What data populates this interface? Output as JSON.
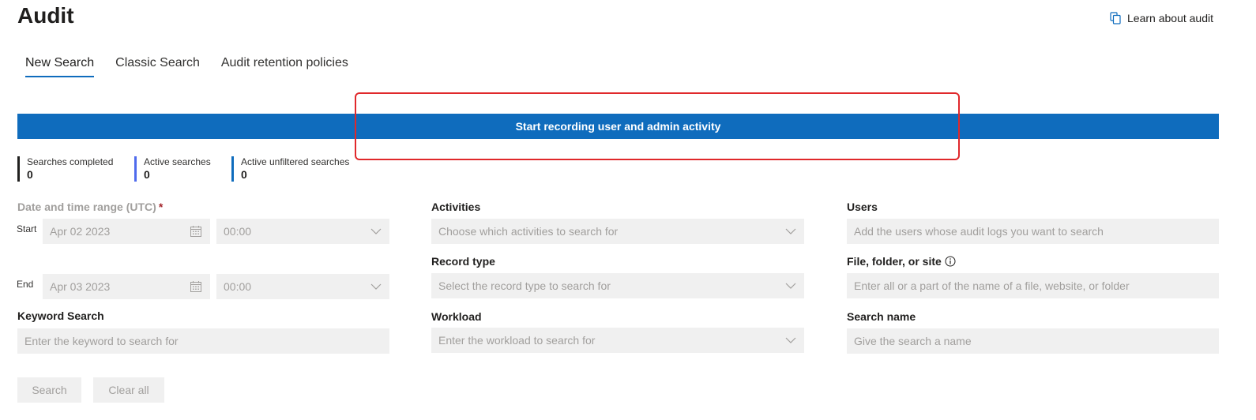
{
  "page": {
    "title": "Audit",
    "learn_link": "Learn about audit"
  },
  "tabs": [
    {
      "label": "New Search",
      "active": true
    },
    {
      "label": "Classic Search",
      "active": false
    },
    {
      "label": "Audit retention policies",
      "active": false
    }
  ],
  "banner": {
    "label": "Start recording user and admin activity"
  },
  "stats": [
    {
      "label": "Searches completed",
      "value": "0",
      "color": "#201f1e"
    },
    {
      "label": "Active searches",
      "value": "0",
      "color": "#4f6bed"
    },
    {
      "label": "Active unfiltered searches",
      "value": "0",
      "color": "#0f6cbd"
    }
  ],
  "form": {
    "date_range": {
      "label": "Date and time range (UTC)",
      "required_mark": "*",
      "start_label": "Start",
      "start_date": "Apr 02 2023",
      "start_time": "00:00",
      "end_label": "End",
      "end_date": "Apr 03 2023",
      "end_time": "00:00"
    },
    "keyword": {
      "label": "Keyword Search",
      "placeholder": "Enter the keyword to search for"
    },
    "activities": {
      "label": "Activities",
      "placeholder": "Choose which activities to search for"
    },
    "record_type": {
      "label": "Record type",
      "placeholder": "Select the record type to search for"
    },
    "workload": {
      "label": "Workload",
      "placeholder": "Enter the workload to search for"
    },
    "users": {
      "label": "Users",
      "placeholder": "Add the users whose audit logs you want to search"
    },
    "file_folder_site": {
      "label": "File, folder, or site",
      "placeholder": "Enter all or a part of the name of a file, website, or folder"
    },
    "search_name": {
      "label": "Search name",
      "placeholder": "Give the search a name"
    }
  },
  "buttons": {
    "search": "Search",
    "clear_all": "Clear all"
  },
  "colors": {
    "accent": "#0f6cbd",
    "highlight": "#e0282b",
    "field_bg": "#f0f0f0",
    "disabled_text": "#a19f9d"
  },
  "icons": {
    "learn_link": "document-copy-icon",
    "calendar": "calendar-icon",
    "chevron": "chevron-down-icon",
    "info": "info-icon"
  }
}
